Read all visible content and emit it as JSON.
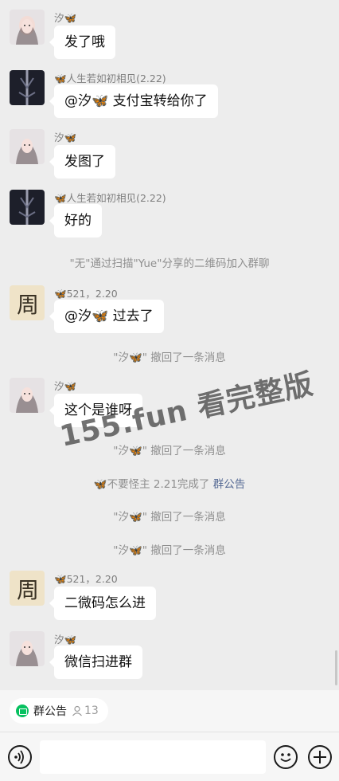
{
  "chat": {
    "messages": [
      {
        "sender": "汐🦋",
        "text": "发了哦"
      },
      {
        "sender": "🦋人生若如初相见(2.22)",
        "text": "@汐🦋 支付宝转给你了"
      },
      {
        "sender": "汐🦋",
        "text": "发图了"
      },
      {
        "sender": "🦋人生若如初相见(2.22)",
        "text": "好的"
      },
      {
        "system": "\"无\"通过扫描\"Yue\"分享的二维码加入群聊"
      },
      {
        "sender": "🦋521，2.20",
        "text": "@汐🦋 过去了"
      },
      {
        "system": "\"汐🦋\" 撤回了一条消息"
      },
      {
        "sender": "汐🦋",
        "text": "这个是谁呀"
      },
      {
        "system": "\"汐🦋\" 撤回了一条消息"
      },
      {
        "system": "🦋不要怪主 2.21完成了",
        "link": "群公告"
      },
      {
        "system": "\"汐🦋\" 撤回了一条消息"
      },
      {
        "system": "\"汐🦋\" 撤回了一条消息"
      },
      {
        "sender": "🦋521，2.20",
        "text": "二微码怎么进"
      },
      {
        "sender": "汐🦋",
        "text": "微信扫进群"
      }
    ]
  },
  "watermark": "155.fun 看完整版",
  "notice": {
    "label": "群公告",
    "member_count": "13"
  },
  "colors": {
    "background": "#ededed",
    "bubble": "#ffffff",
    "link": "#576b95",
    "accent_green": "#07c160"
  },
  "icons": {
    "voice": "voice-icon",
    "emoji": "emoji-icon",
    "more": "plus-icon"
  }
}
